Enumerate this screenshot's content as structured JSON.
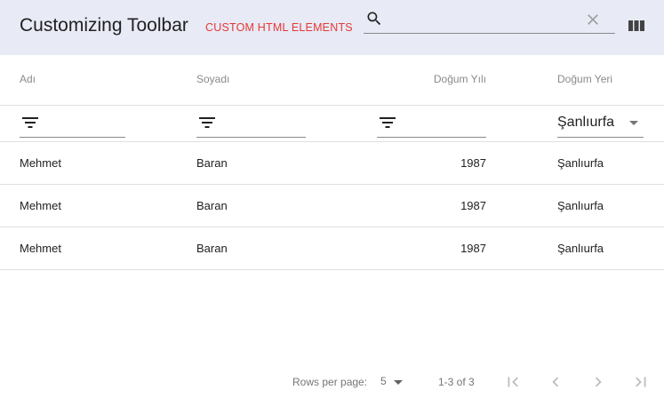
{
  "toolbar": {
    "title": "Customizing Toolbar",
    "custom_label": "CUSTOM HTML ELEMENTS",
    "search": {
      "value": "",
      "placeholder": ""
    }
  },
  "columns": [
    "Adı",
    "Soyadı",
    "Doğum Yılı",
    "Doğum Yeri"
  ],
  "filters": {
    "birth_place_selected": "Şanlıurfa"
  },
  "rows": [
    {
      "name": "Mehmet",
      "surname": "Baran",
      "birth_year": "1987",
      "birth_place": "Şanlıurfa"
    },
    {
      "name": "Mehmet",
      "surname": "Baran",
      "birth_year": "1987",
      "birth_place": "Şanlıurfa"
    },
    {
      "name": "Mehmet",
      "surname": "Baran",
      "birth_year": "1987",
      "birth_place": "Şanlıurfa"
    }
  ],
  "pagination": {
    "rows_per_page_label": "Rows per page:",
    "rows_per_page": "5",
    "range": "1-3 of 3"
  },
  "colors": {
    "toolbar_bg": "#e8eaf6",
    "custom_label": "#e53935"
  },
  "icons": [
    "search-icon",
    "clear-icon",
    "view-column-icon",
    "filter-list-icon",
    "arrow-drop-down-icon",
    "first-page-icon",
    "chevron-left-icon",
    "chevron-right-icon",
    "last-page-icon"
  ]
}
